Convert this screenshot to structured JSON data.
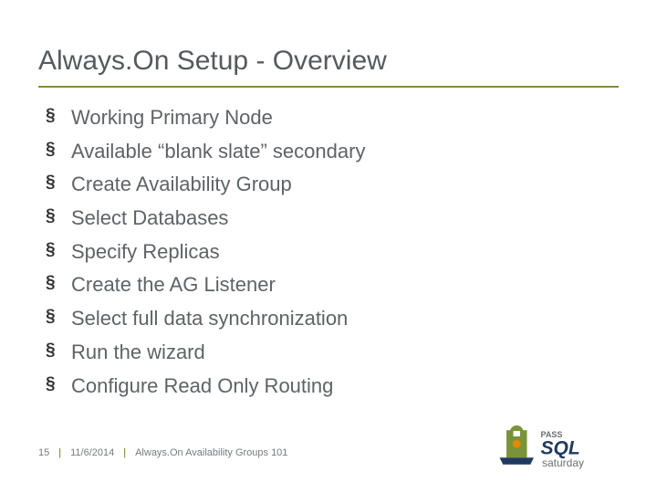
{
  "title": "Always.On Setup - Overview",
  "bullets": [
    "Working Primary Node",
    "Available “blank slate” secondary",
    "Create Availability Group",
    "Select Databases",
    "Specify Replicas",
    "Create the AG Listener",
    "Select full data synchronization",
    "Run the wizard",
    "Configure Read Only Routing"
  ],
  "footer": {
    "page": "15",
    "date": "11/6/2014",
    "presentation_title": "Always.On Availability Groups 101"
  },
  "logo": {
    "text_top": "PASS",
    "text_main": "SQL",
    "text_sub": "saturday"
  }
}
